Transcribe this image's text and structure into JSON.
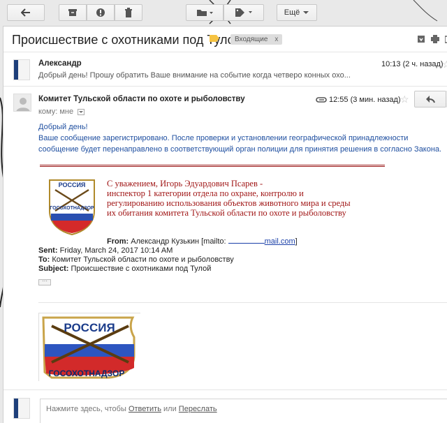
{
  "toolbar": {
    "more_label": "Ещё"
  },
  "thread": {
    "subject": "Происшествие с охотниками под Тулой",
    "label": "Входящие",
    "label_close": "x"
  },
  "message1": {
    "sender": "Александр",
    "snippet": "Добрый день! Прошу обратить Ваше внимание на событие когда четверо конных охо...",
    "time": "10:13 (2 ч. назад)"
  },
  "message2": {
    "sender": "Комитет Тульской области по охоте и рыболовству",
    "time": "12:55 (3 мин. назад)",
    "to_prefix": "кому: мне",
    "body": {
      "greeting": "Добрый день!",
      "line1": "Ваше сообщение зарегистрировано. После проверки и установлении географической принадлежности",
      "line2": "сообщение будет перенаправлено в соответствующий орган полиции  для принятия решения в согласно Закона."
    },
    "signature": {
      "line1": "С уважением, Игорь Эдуардович Псарев -",
      "line2": "инспектор 1 категории отдела по охране, контролю и",
      "line3": "регулированию использования объектов животного мира и среды",
      "line4": "их обитания комитета Тульской области по охоте и рыболовству"
    },
    "logo_text": {
      "top": "РОССИЯ",
      "bottom": "ГОСОХОТНАДЗОР"
    },
    "quoted": {
      "from_label": "From:",
      "from_name": "Александр Кузькин [mailto:",
      "from_email": "mail.com",
      "from_end": "]",
      "sent_label": "Sent:",
      "sent_value": "Friday, March 24, 2017 10:14 AM",
      "to_label": "To:",
      "to_value": "Комитет Тульской области по охоте и рыболовству",
      "subject_label": "Subject:",
      "subject_value": "Происшествие с охотниками под Тулой"
    },
    "attachment_text": {
      "top": "РОССИЯ",
      "bottom": "ГОСОХОТНАДЗОР"
    }
  },
  "reply": {
    "prefix": "Нажмите здесь, чтобы ",
    "reply_link": "Ответить",
    "middle": " или ",
    "forward_link": "Переслать"
  },
  "colors": {
    "label_tag": "#f6c342",
    "signature": "#a01616",
    "body_text": "#1f4fa0"
  }
}
